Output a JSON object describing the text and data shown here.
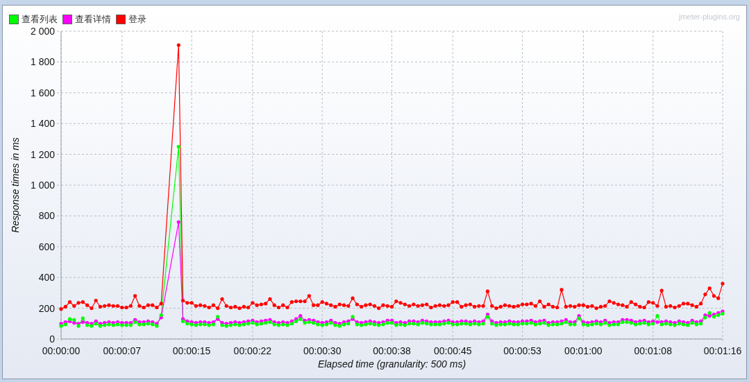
{
  "watermark": "jmeter-plugins.org",
  "chart_data": {
    "type": "line",
    "grid": true,
    "xlabel": "Elapsed time (granularity: 500 ms)",
    "ylabel": "Response times in ms",
    "xlim": [
      0,
      76
    ],
    "ylim": [
      0,
      2000
    ],
    "xticks": [
      {
        "value": 0,
        "label": "00:00:00"
      },
      {
        "value": 7,
        "label": "00:00:07"
      },
      {
        "value": 15,
        "label": "00:00:15"
      },
      {
        "value": 22,
        "label": "00:00:22"
      },
      {
        "value": 30,
        "label": "00:00:30"
      },
      {
        "value": 38,
        "label": "00:00:38"
      },
      {
        "value": 45,
        "label": "00:00:45"
      },
      {
        "value": 53,
        "label": "00:00:53"
      },
      {
        "value": 60,
        "label": "00:01:00"
      },
      {
        "value": 68,
        "label": "00:01:08"
      },
      {
        "value": 76,
        "label": "00:01:16"
      }
    ],
    "yticks": [
      {
        "value": 0,
        "label": "0"
      },
      {
        "value": 200,
        "label": "200"
      },
      {
        "value": 400,
        "label": "400"
      },
      {
        "value": 600,
        "label": "600"
      },
      {
        "value": 800,
        "label": "800"
      },
      {
        "value": 1000,
        "label": "1 000"
      },
      {
        "value": 1200,
        "label": "1 200"
      },
      {
        "value": 1400,
        "label": "1 400"
      },
      {
        "value": 1600,
        "label": "1 600"
      },
      {
        "value": 1800,
        "label": "1 800"
      },
      {
        "value": 2000,
        "label": "2 000"
      }
    ],
    "x": [
      0,
      0.5,
      1,
      1.5,
      2,
      2.5,
      3,
      3.5,
      4,
      4.5,
      5,
      5.5,
      6,
      6.5,
      7,
      7.5,
      8,
      8.5,
      9,
      9.5,
      10,
      10.5,
      11,
      11.5,
      13.5,
      14,
      14.5,
      15,
      15.5,
      16,
      16.5,
      17,
      17.5,
      18,
      18.5,
      19,
      19.5,
      20,
      20.5,
      21,
      21.5,
      22,
      22.5,
      23,
      23.5,
      24,
      24.5,
      25,
      25.5,
      26,
      26.5,
      27,
      27.5,
      28,
      28.5,
      29,
      29.5,
      30,
      30.5,
      31,
      31.5,
      32,
      32.5,
      33,
      33.5,
      34,
      34.5,
      35,
      35.5,
      36,
      36.5,
      37,
      37.5,
      38,
      38.5,
      39,
      39.5,
      40,
      40.5,
      41,
      41.5,
      42,
      42.5,
      43,
      43.5,
      44,
      44.5,
      45,
      45.5,
      46,
      46.5,
      47,
      47.5,
      48,
      48.5,
      49,
      49.5,
      50,
      50.5,
      51,
      51.5,
      52,
      52.5,
      53,
      53.5,
      54,
      54.5,
      55,
      55.5,
      56,
      56.5,
      57,
      57.5,
      58,
      58.5,
      59,
      59.5,
      60,
      60.5,
      61,
      61.5,
      62,
      62.5,
      63,
      63.5,
      64,
      64.5,
      65,
      65.5,
      66,
      66.5,
      67,
      67.5,
      68,
      68.5,
      69,
      69.5,
      70,
      70.5,
      71,
      71.5,
      72,
      72.5,
      73,
      73.5,
      74,
      74.5,
      75,
      75.5,
      76
    ],
    "series": [
      {
        "name": "查看列表",
        "color": "#00ff00",
        "values": [
          85,
          95,
          130,
          125,
          85,
          135,
          90,
          85,
          100,
          85,
          90,
          95,
          90,
          95,
          90,
          90,
          90,
          110,
          95,
          95,
          100,
          95,
          85,
          155,
          1250,
          115,
          100,
          95,
          90,
          95,
          95,
          90,
          95,
          145,
          90,
          85,
          90,
          95,
          90,
          95,
          100,
          105,
          95,
          100,
          105,
          110,
          95,
          90,
          95,
          90,
          100,
          115,
          130,
          105,
          110,
          105,
          95,
          90,
          95,
          105,
          90,
          85,
          95,
          100,
          145,
          95,
          90,
          95,
          100,
          95,
          90,
          95,
          105,
          105,
          90,
          95,
          90,
          100,
          100,
          95,
          105,
          100,
          95,
          95,
          95,
          100,
          105,
          95,
          95,
          100,
          100,
          95,
          100,
          95,
          100,
          145,
          100,
          90,
          95,
          95,
          100,
          95,
          95,
          100,
          100,
          105,
          95,
          100,
          105,
          90,
          95,
          95,
          100,
          110,
          95,
          95,
          135,
          95,
          90,
          95,
          100,
          95,
          105,
          90,
          95,
          95,
          110,
          110,
          105,
          95,
          100,
          105,
          95,
          100,
          150,
          95,
          100,
          95,
          90,
          100,
          95,
          90,
          105,
          95,
          100,
          140,
          170,
          145,
          155,
          165
        ]
      },
      {
        "name": "查看详情",
        "color": "#ff00ff",
        "values": [
          100,
          110,
          115,
          105,
          100,
          110,
          105,
          100,
          115,
          100,
          105,
          110,
          105,
          110,
          105,
          105,
          105,
          125,
          110,
          110,
          115,
          110,
          100,
          140,
          760,
          130,
          115,
          110,
          105,
          110,
          110,
          105,
          110,
          130,
          105,
          100,
          105,
          110,
          105,
          110,
          115,
          120,
          110,
          115,
          120,
          125,
          110,
          105,
          110,
          105,
          115,
          130,
          150,
          120,
          125,
          120,
          110,
          105,
          110,
          120,
          105,
          100,
          110,
          115,
          130,
          110,
          105,
          110,
          115,
          110,
          105,
          110,
          120,
          120,
          105,
          110,
          105,
          115,
          115,
          110,
          120,
          115,
          110,
          110,
          110,
          115,
          120,
          110,
          110,
          115,
          115,
          110,
          115,
          110,
          115,
          160,
          115,
          105,
          110,
          110,
          115,
          110,
          110,
          115,
          115,
          120,
          110,
          115,
          120,
          105,
          110,
          110,
          115,
          125,
          110,
          110,
          150,
          110,
          105,
          110,
          115,
          110,
          120,
          105,
          110,
          110,
          125,
          125,
          120,
          110,
          115,
          120,
          110,
          115,
          110,
          110,
          115,
          110,
          105,
          115,
          110,
          105,
          120,
          110,
          115,
          155,
          150,
          160,
          170,
          180
        ]
      },
      {
        "name": "登录",
        "color": "#ff0000",
        "values": [
          195,
          210,
          240,
          215,
          235,
          240,
          220,
          200,
          250,
          210,
          215,
          220,
          215,
          215,
          205,
          205,
          215,
          280,
          215,
          205,
          220,
          220,
          205,
          230,
          1910,
          250,
          235,
          235,
          215,
          220,
          215,
          205,
          220,
          200,
          260,
          215,
          205,
          210,
          200,
          210,
          205,
          235,
          220,
          225,
          230,
          260,
          220,
          205,
          220,
          205,
          240,
          245,
          245,
          245,
          280,
          220,
          220,
          240,
          230,
          220,
          210,
          225,
          220,
          215,
          265,
          225,
          210,
          220,
          225,
          215,
          200,
          220,
          215,
          210,
          245,
          235,
          225,
          215,
          225,
          215,
          220,
          225,
          205,
          215,
          220,
          215,
          220,
          240,
          240,
          210,
          220,
          225,
          210,
          215,
          215,
          310,
          215,
          200,
          210,
          220,
          215,
          210,
          215,
          225,
          225,
          230,
          215,
          245,
          210,
          225,
          210,
          205,
          320,
          210,
          215,
          210,
          220,
          220,
          210,
          215,
          200,
          210,
          215,
          245,
          235,
          225,
          220,
          210,
          240,
          225,
          210,
          205,
          240,
          235,
          215,
          315,
          210,
          215,
          205,
          215,
          230,
          230,
          220,
          210,
          230,
          290,
          330,
          280,
          265,
          360
        ]
      }
    ]
  }
}
